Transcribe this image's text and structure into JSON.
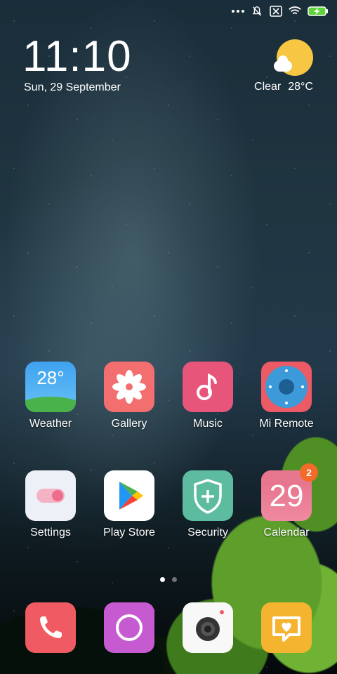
{
  "status_bar": {
    "icons": [
      "more-dots-icon",
      "notifications-off-icon",
      "no-sim-icon",
      "wifi-icon",
      "battery-charging-icon"
    ]
  },
  "home": {
    "clock": "11:10",
    "date": "Sun, 29 September",
    "weather": {
      "condition": "Clear",
      "temperature": "28°C",
      "icon": "sunny-partly-cloudy-icon"
    }
  },
  "apps_row1": [
    {
      "label": "Weather",
      "icon": "weather-icon",
      "temp": "28°"
    },
    {
      "label": "Gallery",
      "icon": "gallery-icon"
    },
    {
      "label": "Music",
      "icon": "music-icon"
    },
    {
      "label": "Mi Remote",
      "icon": "mi-remote-icon"
    }
  ],
  "apps_row2": [
    {
      "label": "Settings",
      "icon": "settings-icon"
    },
    {
      "label": "Play Store",
      "icon": "play-store-icon"
    },
    {
      "label": "Security",
      "icon": "security-icon"
    },
    {
      "label": "Calendar",
      "icon": "calendar-icon",
      "day": "29",
      "badge": "2"
    }
  ],
  "dock": [
    {
      "icon": "phone-icon"
    },
    {
      "icon": "messaging-icon"
    },
    {
      "icon": "camera-icon"
    },
    {
      "icon": "feedback-icon"
    }
  ],
  "pager": {
    "pages": 2,
    "active": 1
  },
  "colors": {
    "accent_sun": "#f7c743",
    "badge": "#f36a2a"
  }
}
